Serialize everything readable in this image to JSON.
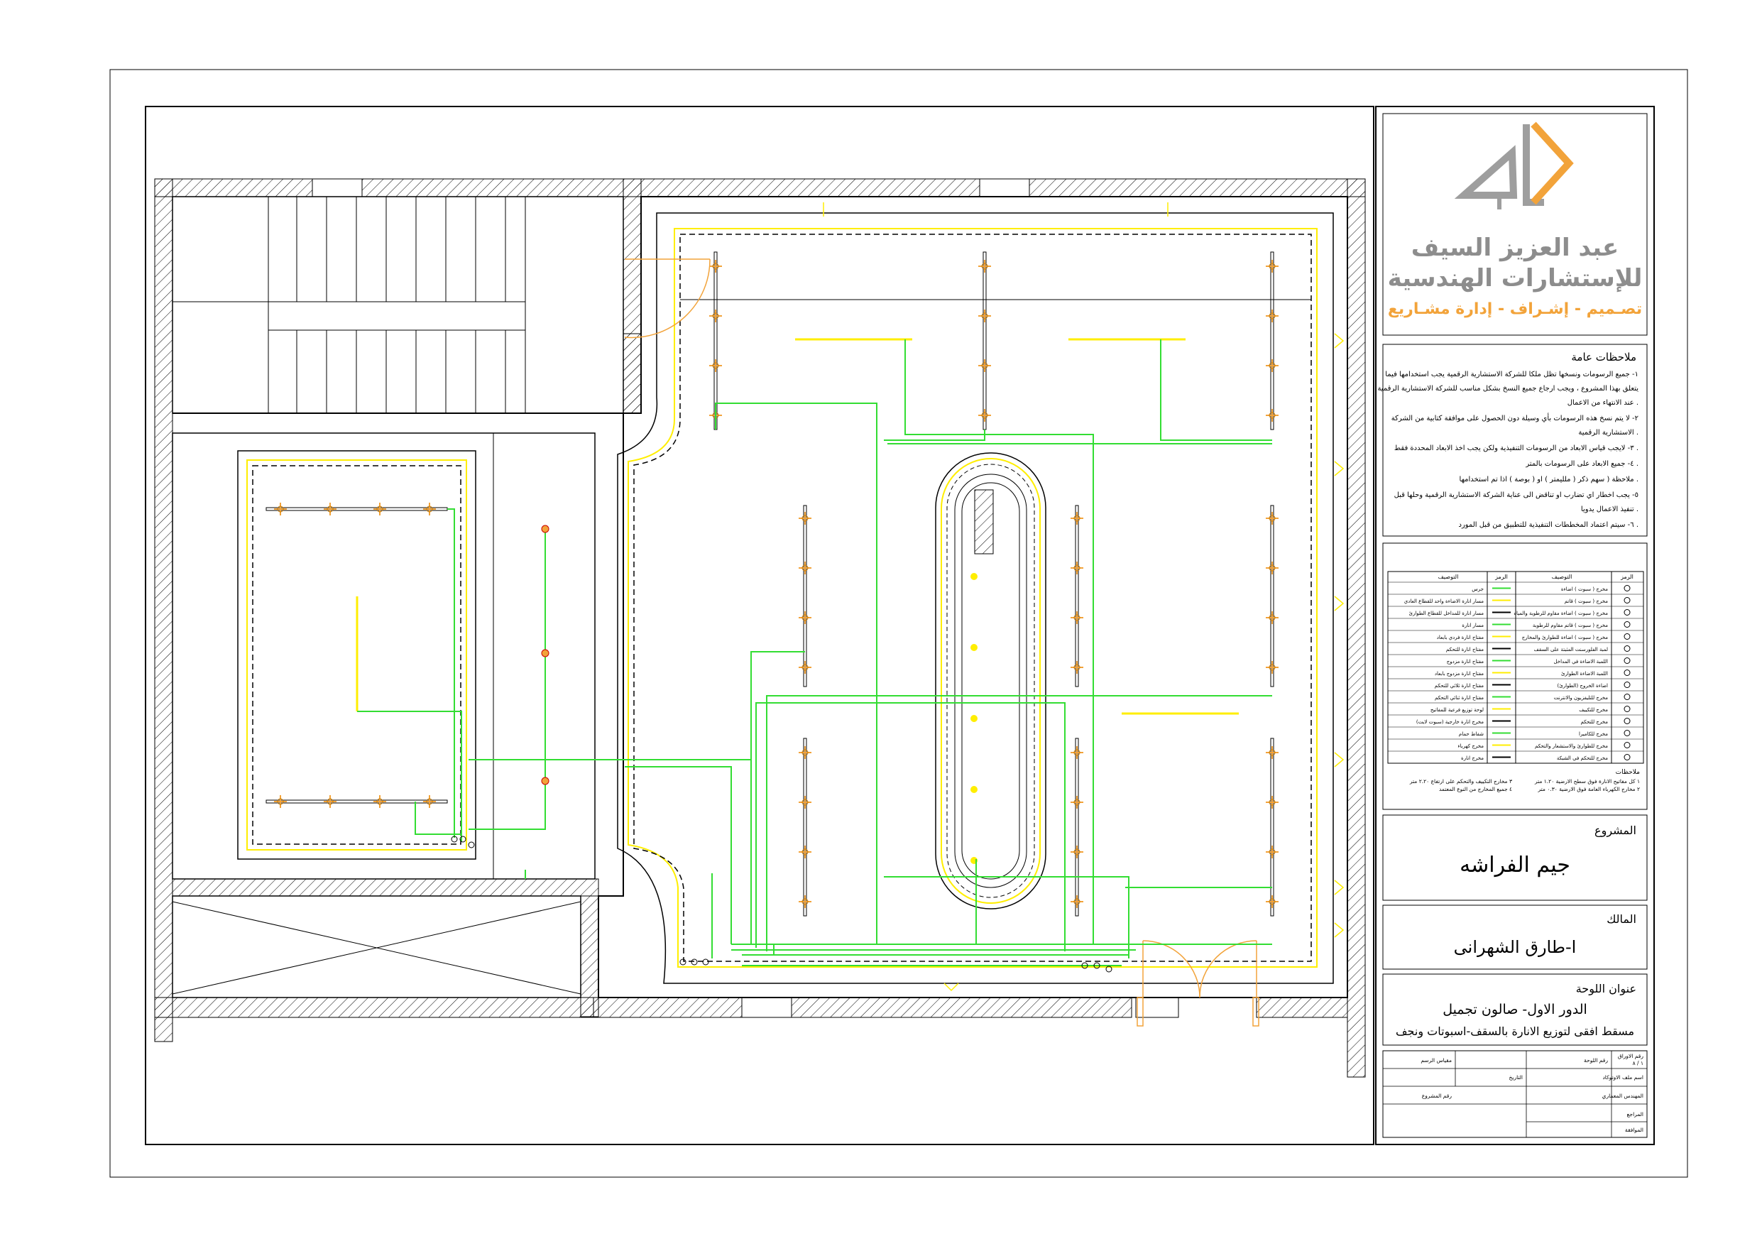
{
  "company": {
    "name_line1": "عبد العزيز السيف",
    "name_line2": "للإستشارات الهندسية",
    "services": "تصـميم - إشـراف - إدارة مشـاريع",
    "logo_colors": {
      "gray": "#9e9e9e",
      "orange": "#f2a33a"
    }
  },
  "notes": {
    "heading": "ملاحظات عامة",
    "items": [
      "١- جميع الرسومات ونسخها تظل ملكا للشركة الاستشارية الرقمية يجب استخدامها فيما",
      "يتعلق بهذا المشروع ، ويجب ارجاع جميع النسخ بشكل مناسب للشركة الاستشارية الرقمية",
      "عند الانتهاء من الاعمال .",
      "٢- لا يتم نسخ هذه الرسومات بأي وسيلة دون الحصول على موافقة كتابية من الشركة",
      "الاستشارية الرقمية .",
      "٣- لايجب قياس الابعاد من الرسومات التنفيذية ولكن يجب اخذ الابعاد المحددة فقط .",
      "٤- جميع الابعاد على الرسومات بالمتر .",
      "ملاحظة ( سهم ذكر ( ملليمتر ) او ( بوصة ) اذا تم استخدامها .",
      "٥- يجب اخطار اي تضارب او تناقض الى عناية الشركة الاستشارية الرقمية وحلها قبل",
      "تنفيذ الاعمال يدويا .",
      "٦- سيتم اعتماد المخططات التنفيذية للتطبيق من قبل المورد ."
    ]
  },
  "legend": {
    "header_desc": "التوصيف",
    "header_symbol": "الرمز",
    "left_rows": [
      "جرس",
      "مسار انارة الاضاءة واحد للقطاع العادي",
      "مسار انارة للمداخل للقطاع الطوارئ",
      "مسار انارة",
      "مفتاح انارة فردي بابعاد",
      "مفتاح انارة للتحكم",
      "مفتاح انارة مزدوج",
      "مفتاح انارة مزدوج بابعاد",
      "مفتاح انارة ثلاثي للتحكم",
      "مفتاح انارة ثنائي التحكم",
      "لوحة توزيع فرعية للمفاتيح",
      "مخرج انارة خارجية (سبوت لايت)",
      "شفاط حمام",
      "مخرج كهرباء",
      "مخرج انارة"
    ],
    "right_rows": [
      "مخرج ( سبوت ) اضاءة",
      "مخرج ( سبوت ) قاتم",
      "مخرج ( سبوت ) اضاءة مقاوم للرطوبة والمياه",
      "مخرج ( سبوت ) قاتم مقاوم للرطوبة",
      "مخرج ( سبوت ) اضاءة للطوارئ والمخارج",
      "لمبة الفلورسنت المثبتة على السقف",
      "اللمبة الاضاءة في المداخل",
      "اللمبة الاضاءة الطوارئ",
      "اضاءة الخروج (الطوارئ)",
      "مخرج للتليفزيون والانترنت",
      "مخرج للتكييف",
      "مخرج للتحكم",
      "مخرج للكاميرا",
      "مخرج للطوارئ والاستشعار والتحكم",
      "مخرج للتحكم في الشبكة"
    ],
    "notes_heading": "ملاحظات",
    "notes_lines": [
      "١ كل مفاتيح الانارة فوق سطح الارضية ١.٢٠ متر",
      "٢ مخارج الكهرباء العامة فوق الارضية ٠.٣٠ متر",
      "٣ مخارج التكييف والتحكم على ارتفاع ٢.٢٠ متر",
      "٤ جميع المخارج من النوع المعتمد"
    ]
  },
  "project": {
    "label": "المشروع",
    "value": "جيم الفراشه"
  },
  "owner": {
    "label": "المالك",
    "value": "ا-طارق الشهرانى"
  },
  "sheet_title": {
    "label": "عنوان اللوحة",
    "line1": "الدور الاول- صالون تجميل",
    "line2": "مسقط افقى لتوزيع الانارة بالسقف-اسبوتات ونجف"
  },
  "info_table": {
    "rows": [
      {
        "c1": "رقم اللوحة",
        "c2": "مقياس الرسم",
        "c3": "",
        "c4": "رقم الاوراق"
      },
      {
        "c1": "اسم ملف الاوتوكاد",
        "c2": "",
        "c3": "",
        "c4": "١ / ٨"
      },
      {
        "c1": "المهندس المعماري",
        "c2": "التاريخ",
        "c3": "",
        "c4": ""
      },
      {
        "c1": "المراجع",
        "c2": "رقم المشروع",
        "c3": "",
        "c4": ""
      },
      {
        "c1": "الموافقة",
        "c2": "",
        "c3": "",
        "c4": ""
      }
    ]
  },
  "colors": {
    "wire": "#33dd33",
    "light": "#ffee00",
    "fixture": "#f2a33a",
    "wall": "#000000"
  }
}
